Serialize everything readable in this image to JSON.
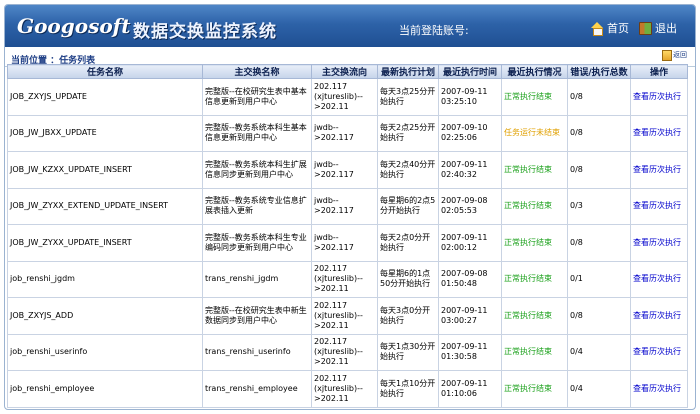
{
  "header": {
    "logo_text": "Googosoft",
    "system_title": "数据交换监控系统",
    "login_label": "当前登陆账号:",
    "nav": [
      {
        "label": "首页",
        "icon": "home-icon"
      },
      {
        "label": "退出",
        "icon": "exit-icon"
      }
    ]
  },
  "breadcrumb": {
    "text": "当前位置 ：任务列表",
    "back_label": "返回"
  },
  "table": {
    "columns": [
      "任务名称",
      "主交换名称",
      "主交换流向",
      "最新执行计划",
      "最近执行时间",
      "最近执行情况",
      "错误/执行总数",
      "操作"
    ],
    "rows": [
      {
        "task": "JOB_ZXYJS_UPDATE",
        "name": "完整版--在校研究生表中基本信息更新到用户中心",
        "flow": "202.117 (xjtureslib)-- >202.11",
        "plan": "每天3点25分开始执行",
        "time": "2007-09-11 03:25:10",
        "status": "正常执行结束",
        "status_class": "green",
        "count": "0/8",
        "action": "查看历次执行"
      },
      {
        "task": "JOB_JW_JBXX_UPDATE",
        "name": "完整版--教务系统本科生基本信息更新到用户中心",
        "flow": "jwdb-- >202.117",
        "plan": "每天2点25分开始执行",
        "time": "2007-09-10 02:25:06",
        "status": "任务运行未结束",
        "status_class": "orange",
        "count": "0/8",
        "action": "查看历次执行"
      },
      {
        "task": "JOB_JW_KZXX_UPDATE_INSERT",
        "name": "完整版--教务系统本科生扩展信息同步更新到用户中心",
        "flow": "jwdb-- >202.117",
        "plan": "每天2点40分开始执行",
        "time": "2007-09-11 02:40:32",
        "status": "正常执行结束",
        "status_class": "green",
        "count": "0/8",
        "action": "查看历次执行"
      },
      {
        "task": "JOB_JW_ZYXX_EXTEND_UPDATE_INSERT",
        "name": "完整版--教务系统专业信息扩展表插入更新",
        "flow": "jwdb-- >202.117",
        "plan": "每星期6的2点5分开始执行",
        "time": "2007-09-08 02:05:53",
        "status": "正常执行结束",
        "status_class": "green",
        "count": "0/3",
        "action": "查看历次执行"
      },
      {
        "task": "JOB_JW_ZYXX_UPDATE_INSERT",
        "name": "完整版--教务系统本科生专业编码同步更新到用户中心",
        "flow": "jwdb-- >202.117",
        "plan": "每天2点0分开始执行",
        "time": "2007-09-11 02:00:12",
        "status": "正常执行结束",
        "status_class": "green",
        "count": "0/8",
        "action": "查看历次执行"
      },
      {
        "task": "job_renshi_jgdm",
        "name": "trans_renshi_jgdm",
        "flow": "202.117 (xjtureslib)-- >202.11",
        "plan": "每星期6的1点50分开始执行",
        "time": "2007-09-08 01:50:48",
        "status": "正常执行结束",
        "status_class": "green",
        "count": "0/1",
        "action": "查看历次执行"
      },
      {
        "task": "JOB_ZXYJS_ADD",
        "name": "完整版--在校研究生表中新生数据同步到用户中心",
        "flow": "202.117 (xjtureslib)-- >202.11",
        "plan": "每天3点0分开始执行",
        "time": "2007-09-11 03:00:27",
        "status": "正常执行结束",
        "status_class": "green",
        "count": "0/8",
        "action": "查看历次执行"
      },
      {
        "task": "job_renshi_userinfo",
        "name": "trans_renshi_userinfo",
        "flow": "202.117 (xjtureslib)-- >202.11",
        "plan": "每天1点30分开始执行",
        "time": "2007-09-11 01:30:58",
        "status": "正常执行结束",
        "status_class": "green",
        "count": "0/4",
        "action": "查看历次执行"
      },
      {
        "task": "job_renshi_employee",
        "name": "trans_renshi_employee",
        "flow": "202.117 (xjtureslib)-- >202.11",
        "plan": "每天1点10分开始执行",
        "time": "2007-09-11 01:10:06",
        "status": "正常执行结束",
        "status_class": "green",
        "count": "0/4",
        "action": "查看历次执行"
      }
    ]
  }
}
